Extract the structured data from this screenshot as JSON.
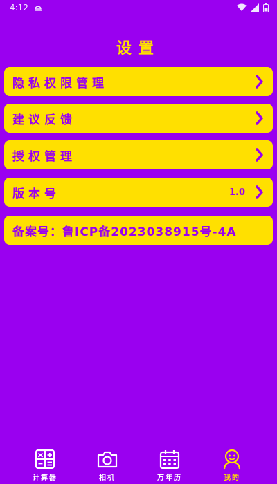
{
  "status_bar": {
    "time": "4:12"
  },
  "page": {
    "title": "设置"
  },
  "menu": [
    {
      "label": "隐私权限管理",
      "value": ""
    },
    {
      "label": "建议反馈",
      "value": ""
    },
    {
      "label": "授权管理",
      "value": ""
    },
    {
      "label": "版本号",
      "value": "1.0"
    }
  ],
  "filing": {
    "text": "备案号：鲁ICP备2023038915号-4A"
  },
  "nav": [
    {
      "label": "计算器",
      "icon": "calculator-icon"
    },
    {
      "label": "相机",
      "icon": "camera-icon"
    },
    {
      "label": "万年历",
      "icon": "calendar-icon"
    },
    {
      "label": "我的",
      "icon": "smiley-icon",
      "active": true
    }
  ],
  "colors": {
    "background": "#9a00f0",
    "accent": "#ffe000",
    "text_on_accent": "#9a00f0"
  }
}
